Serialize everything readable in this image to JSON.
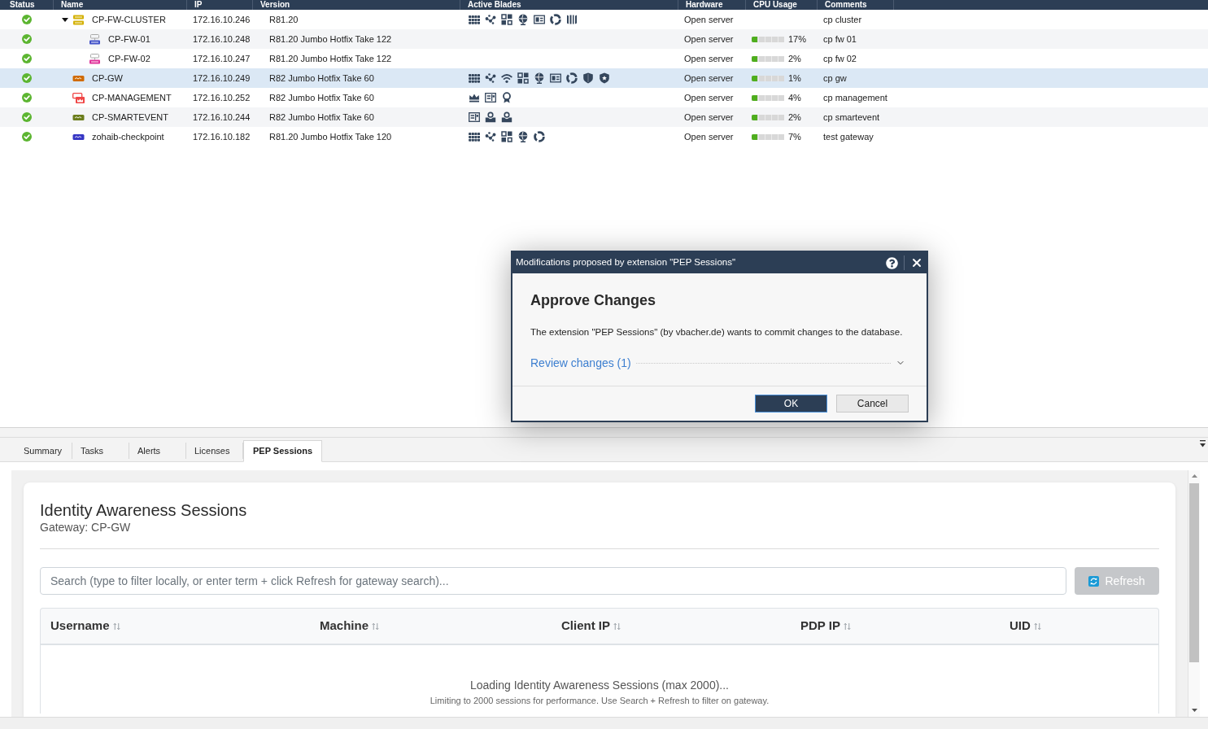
{
  "device_table": {
    "columns": [
      "Status",
      "Name",
      "IP",
      "Version",
      "Active Blades",
      "Hardware",
      "CPU Usage",
      "Comments"
    ]
  },
  "devices": [
    {
      "healthy": true,
      "name": "CP-FW-CLUSTER",
      "device": {
        "kind": "cluster",
        "color": "#d4b106"
      },
      "ip": "172.16.10.246",
      "version": "R81.20",
      "blades": [
        {
          "kind": "grid"
        },
        {
          "kind": "nodes"
        },
        {
          "kind": "tiles"
        },
        {
          "kind": "globe"
        },
        {
          "kind": "card"
        },
        {
          "kind": "ring"
        },
        {
          "kind": "bars"
        }
      ],
      "hardware": "Open server",
      "comments": "cp cluster",
      "selected": false,
      "expanded": true,
      "children": [
        {
          "healthy": true,
          "name": "CP-FW-01",
          "device": {
            "kind": "member",
            "color": "#4353c9"
          },
          "ip": "172.16.10.248",
          "version": "R81.20 Jumbo Hotfix Take 122",
          "hardware": "Open server",
          "cpu": {
            "level": 0.17,
            "reading": "17%"
          },
          "comments": "cp fw 01",
          "selected": false
        },
        {
          "healthy": true,
          "name": "CP-FW-02",
          "device": {
            "kind": "member",
            "color": "#e0339b"
          },
          "ip": "172.16.10.247",
          "version": "R81.20 Jumbo Hotfix Take 122",
          "hardware": "Open server",
          "cpu": {
            "level": 0.02,
            "reading": "2%"
          },
          "comments": "cp fw 02",
          "selected": false
        }
      ]
    },
    {
      "healthy": true,
      "name": "CP-GW",
      "device": {
        "kind": "gateway",
        "color": "#d06a00"
      },
      "ip": "172.16.10.249",
      "version": "R82 Jumbo Hotfix Take 60",
      "blades": [
        {
          "kind": "grid"
        },
        {
          "kind": "nodes"
        },
        {
          "kind": "wifi"
        },
        {
          "kind": "tiles"
        },
        {
          "kind": "globe"
        },
        {
          "kind": "card"
        },
        {
          "kind": "ring"
        },
        {
          "kind": "shield"
        },
        {
          "kind": "badge"
        }
      ],
      "hardware": "Open server",
      "cpu": {
        "level": 0.01,
        "reading": "1%"
      },
      "comments": "cp gw",
      "selected": true
    },
    {
      "healthy": true,
      "name": "CP-MANAGEMENT",
      "device": {
        "kind": "management",
        "color": "#f04646"
      },
      "ip": "172.16.10.252",
      "version": "R82 Jumbo Hotfix Take 60",
      "blades": [
        {
          "kind": "crown"
        },
        {
          "kind": "panel"
        },
        {
          "kind": "award"
        }
      ],
      "hardware": "Open server",
      "cpu": {
        "level": 0.04,
        "reading": "4%"
      },
      "comments": "cp management",
      "selected": false
    },
    {
      "healthy": true,
      "name": "CP-SMARTEVENT",
      "device": {
        "kind": "gateway",
        "color": "#6b7d1c"
      },
      "ip": "172.16.10.244",
      "version": "R82 Jumbo Hotfix Take 60",
      "blades": [
        {
          "kind": "panel"
        },
        {
          "kind": "inbox"
        },
        {
          "kind": "inbox"
        }
      ],
      "hardware": "Open server",
      "cpu": {
        "level": 0.02,
        "reading": "2%"
      },
      "comments": "cp smartevent",
      "selected": false
    },
    {
      "healthy": true,
      "name": "zohaib-checkpoint",
      "device": {
        "kind": "gateway",
        "color": "#3636c4"
      },
      "ip": "172.16.10.182",
      "version": "R81.20 Jumbo Hotfix Take 120",
      "blades": [
        {
          "kind": "grid"
        },
        {
          "kind": "nodes"
        },
        {
          "kind": "tiles"
        },
        {
          "kind": "globe"
        },
        {
          "kind": "ring"
        }
      ],
      "hardware": "Open server",
      "cpu": {
        "level": 0.07,
        "reading": "7%"
      },
      "comments": "test gateway",
      "selected": false
    }
  ],
  "detail_tabs": [
    {
      "label": "Summary",
      "selected": false
    },
    {
      "label": "Tasks",
      "selected": false
    },
    {
      "label": "Alerts",
      "selected": false
    },
    {
      "label": "Licenses",
      "selected": false
    },
    {
      "label": "PEP Sessions",
      "selected": true
    }
  ],
  "panel": {
    "title": "Identity Awareness Sessions",
    "subtitle": "Gateway: CP-GW",
    "search": {
      "placeholder": "Search (type to filter locally, or enter term + click Refresh for gateway search)..."
    },
    "refresh_button": {
      "label": "Refresh",
      "disabled": true
    },
    "table": {
      "columns": [
        "Username",
        "Machine",
        "Client IP",
        "PDP IP",
        "UID"
      ]
    },
    "loading": "Loading Identity Awareness Sessions (max 2000)...",
    "hint": "Limiting to 2000 sessions for performance. Use Search + Refresh to filter on gateway."
  },
  "dialog": {
    "title": "Modifications proposed by extension \"PEP Sessions\"",
    "heading": "Approve Changes",
    "message": "The extension \"PEP Sessions\" (by vbacher.de) wants to commit changes to the database.",
    "review": {
      "label": "Review changes (1)",
      "expanded": false
    },
    "buttons": [
      {
        "label": "OK",
        "kind": "primary"
      },
      {
        "label": "Cancel",
        "kind": "secondary"
      }
    ]
  }
}
